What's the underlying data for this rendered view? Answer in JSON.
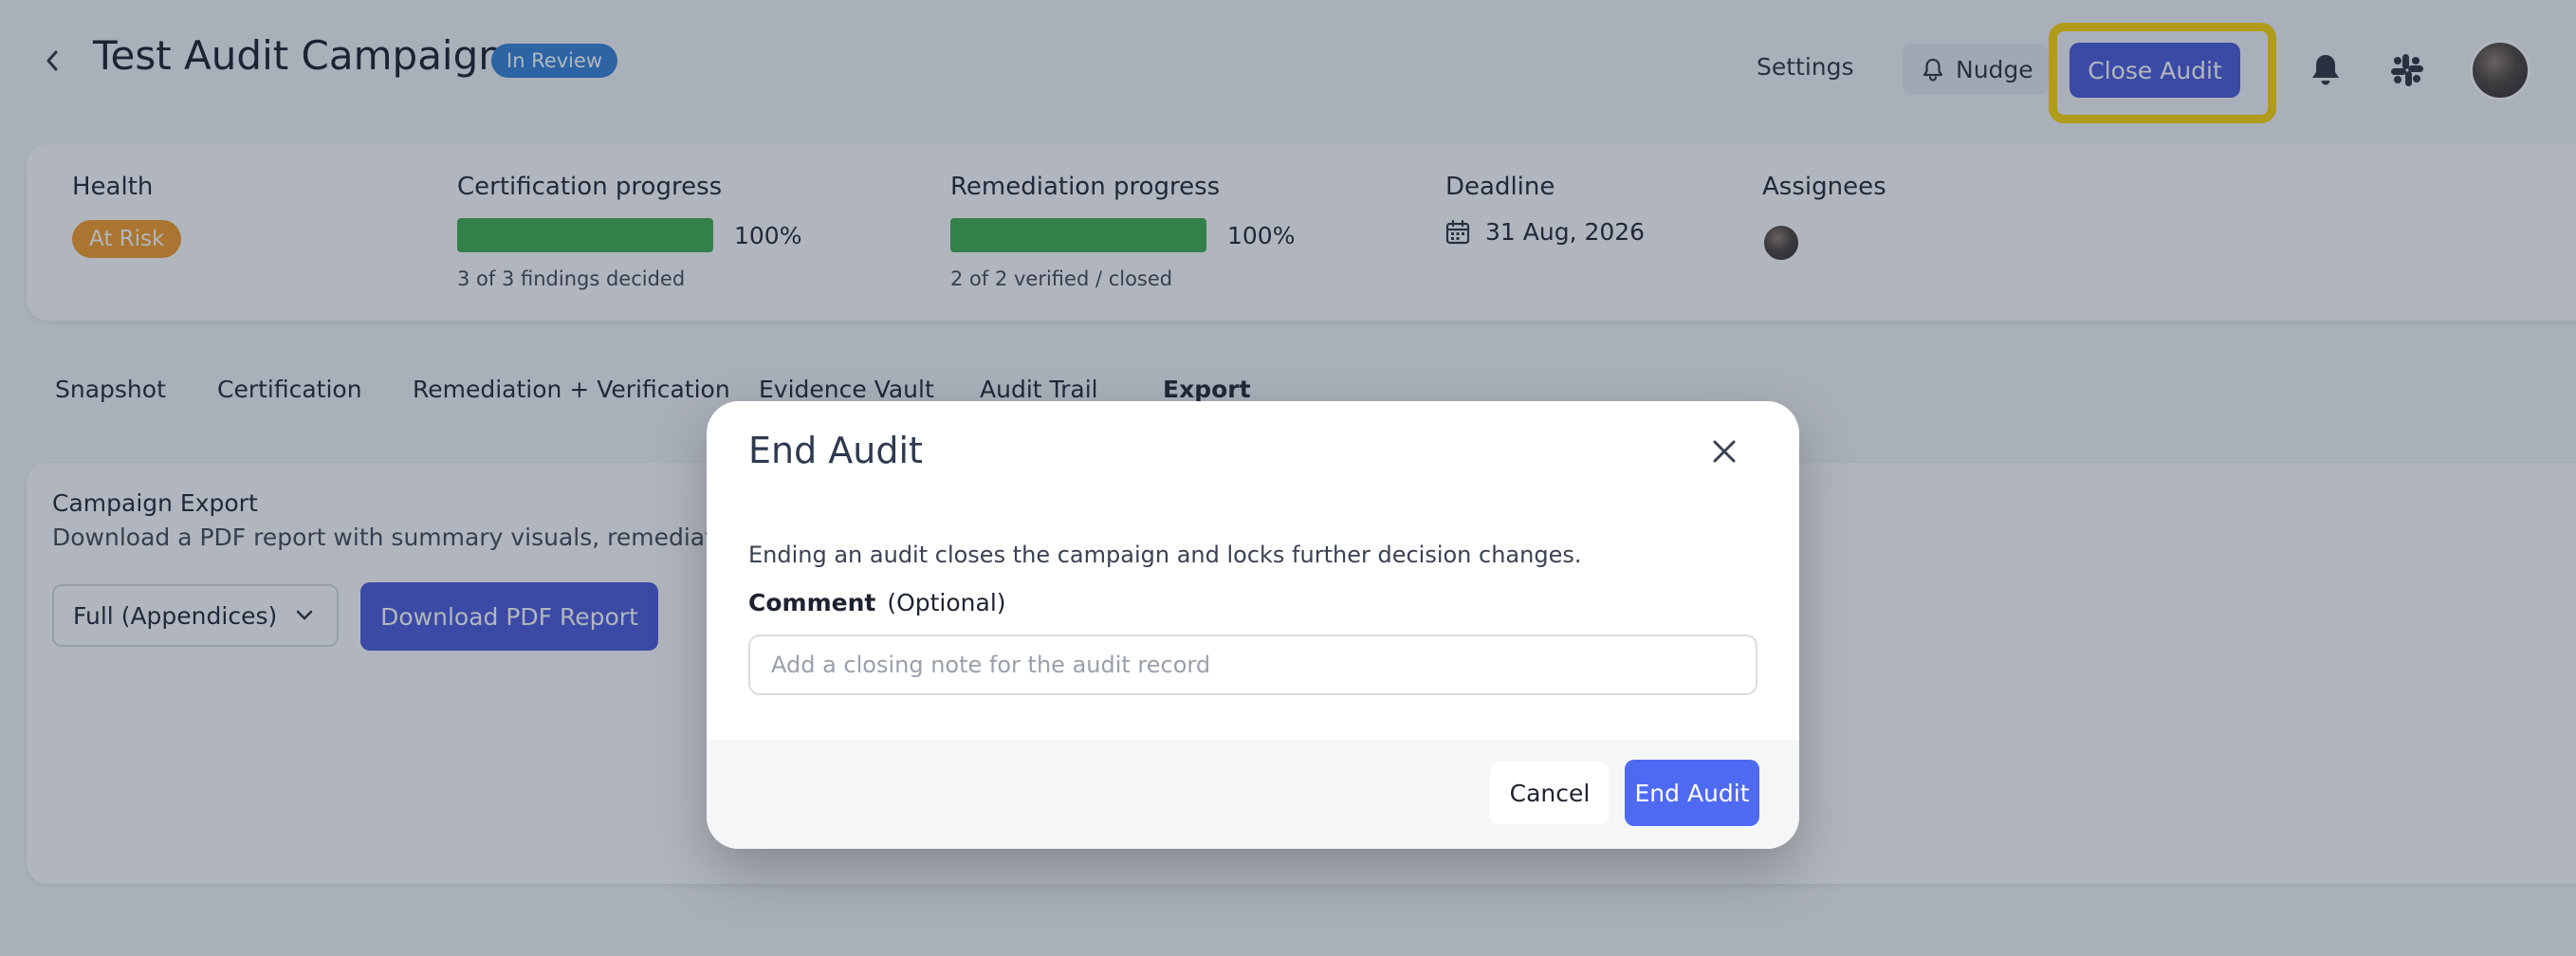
{
  "header": {
    "title": "Test Audit Campaign",
    "status_badge": "In Review",
    "settings_label": "Settings",
    "nudge_label": "Nudge",
    "close_audit_label": "Close Audit"
  },
  "summary": {
    "health": {
      "label": "Health",
      "value": "At Risk"
    },
    "certification": {
      "label": "Certification progress",
      "percent_label": "100%",
      "progress": 1.0,
      "detail": "3 of 3 findings decided"
    },
    "remediation": {
      "label": "Remediation progress",
      "percent_label": "100%",
      "progress": 1.0,
      "detail": "2 of 2 verified / closed"
    },
    "deadline": {
      "label": "Deadline",
      "value": "31 Aug, 2026"
    },
    "assignees": {
      "label": "Assignees"
    }
  },
  "tabs": [
    {
      "label": "Snapshot"
    },
    {
      "label": "Certification"
    },
    {
      "label": "Remediation + Verification"
    },
    {
      "label": "Evidence Vault"
    },
    {
      "label": "Audit Trail"
    },
    {
      "label": "Export"
    }
  ],
  "export": {
    "title": "Campaign Export",
    "description": "Download a PDF report with summary visuals, remediation ou",
    "select_value": "Full (Appendices)",
    "download_label": "Download PDF Report"
  },
  "modal": {
    "title": "End Audit",
    "body": "Ending an audit closes the campaign and locks further decision changes.",
    "comment_label": "Comment",
    "comment_optional": "(Optional)",
    "comment_placeholder": "Add a closing note for the audit record",
    "cancel_label": "Cancel",
    "confirm_label": "End Audit"
  },
  "colors": {
    "primary": "#4756d6",
    "confirm": "#4f6af2",
    "highlight": "#ffd500",
    "progress": "#3aab4a",
    "risk": "#f29a23",
    "badge": "#2f7fd6"
  },
  "icons": {
    "back": "chevron-left-icon",
    "nudge": "bell-outline-icon",
    "notifications": "bell-icon",
    "slack": "slack-icon",
    "calendar": "calendar-icon",
    "dropdown": "chevron-down-icon",
    "close": "close-icon"
  }
}
